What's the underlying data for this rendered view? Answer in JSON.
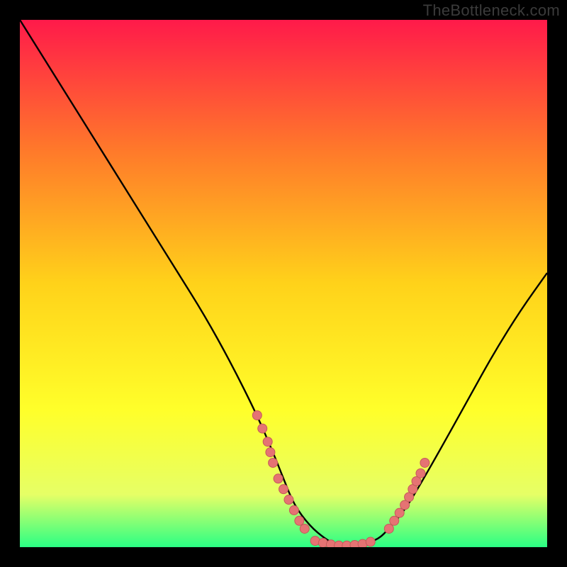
{
  "watermark": "TheBottleneck.com",
  "colors": {
    "gradient_top": "#ff1a4a",
    "gradient_mid1": "#ff7a2a",
    "gradient_mid2": "#ffd21a",
    "gradient_mid3": "#ffff2a",
    "gradient_mid4": "#e6ff66",
    "gradient_bottom": "#2aff84",
    "curve": "#000000",
    "dot_fill": "#e57373",
    "dot_stroke": "#c45a5a",
    "frame": "#000000"
  },
  "chart_data": {
    "type": "line",
    "title": "",
    "xlabel": "",
    "ylabel": "",
    "xlim": [
      0,
      100
    ],
    "ylim": [
      0,
      100
    ],
    "series": [
      {
        "name": "bottleneck-curve",
        "x": [
          0,
          5,
          10,
          15,
          20,
          25,
          30,
          35,
          40,
          45,
          48,
          50,
          52,
          55,
          58,
          60,
          62,
          65,
          68,
          70,
          73,
          76,
          80,
          85,
          90,
          95,
          100
        ],
        "y": [
          100,
          92,
          84,
          76,
          68,
          60,
          52,
          44,
          35,
          25,
          18,
          13,
          8,
          4,
          1.5,
          0.5,
          0.3,
          0.5,
          1.5,
          3.5,
          7,
          12,
          19,
          28,
          37,
          45,
          52
        ]
      }
    ],
    "dots_left": {
      "x": [
        45,
        46,
        47,
        47.5,
        48,
        49,
        50,
        51,
        52,
        53,
        54
      ],
      "y": [
        25,
        22.5,
        20,
        18,
        16,
        13,
        11,
        9,
        7,
        5,
        3.5
      ]
    },
    "dots_bottom": {
      "x": [
        56,
        57.5,
        59,
        60.5,
        62,
        63.5,
        65,
        66.5
      ],
      "y": [
        1.2,
        0.8,
        0.5,
        0.3,
        0.3,
        0.4,
        0.6,
        1.0
      ]
    },
    "dots_right": {
      "x": [
        70,
        71,
        72,
        73,
        73.8,
        74.5,
        75.2,
        76,
        76.8
      ],
      "y": [
        3.5,
        5,
        6.5,
        8,
        9.5,
        11,
        12.5,
        14,
        16
      ]
    }
  }
}
